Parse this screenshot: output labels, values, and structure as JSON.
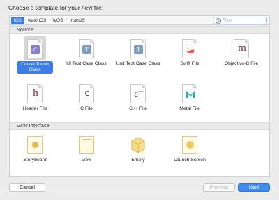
{
  "dialog": {
    "title": "Choose a template for your new file:"
  },
  "platforms": [
    {
      "label": "iOS",
      "selected": true
    },
    {
      "label": "watchOS",
      "selected": false
    },
    {
      "label": "tvOS",
      "selected": false
    },
    {
      "label": "macOS",
      "selected": false
    }
  ],
  "filter": {
    "placeholder": "Filter",
    "value": ""
  },
  "sections": {
    "source": {
      "title": "Source",
      "items": [
        {
          "label": "Cocoa Touch Class",
          "icon": "cocoa-touch-class-icon",
          "selected": true
        },
        {
          "label": "UI Test Case Class",
          "icon": "ui-test-case-class-icon"
        },
        {
          "label": "Unit Test Case Class",
          "icon": "unit-test-case-class-icon"
        },
        {
          "label": "Swift File",
          "icon": "swift-file-icon"
        },
        {
          "label": "Objective-C File",
          "icon": "objective-c-file-icon"
        },
        {
          "label": "Header File",
          "icon": "header-file-icon"
        },
        {
          "label": "C File",
          "icon": "c-file-icon"
        },
        {
          "label": "C++ File",
          "icon": "cpp-file-icon"
        },
        {
          "label": "Metal File",
          "icon": "metal-file-icon"
        }
      ]
    },
    "user_interface": {
      "title": "User Interface",
      "items": [
        {
          "label": "Storyboard",
          "icon": "storyboard-icon"
        },
        {
          "label": "View",
          "icon": "view-icon"
        },
        {
          "label": "Empty",
          "icon": "empty-icon"
        },
        {
          "label": "Launch Screen",
          "icon": "launch-screen-icon"
        }
      ]
    }
  },
  "buttons": {
    "cancel": "Cancel",
    "previous": "Previous",
    "next": "Next"
  },
  "colors": {
    "accent": "#3d7ee6",
    "primary_button": "#3d8ef0",
    "swift": "#f05138",
    "metal": "#2bb59a",
    "objc": "#7a1f4d",
    "header": "#a8163c"
  }
}
